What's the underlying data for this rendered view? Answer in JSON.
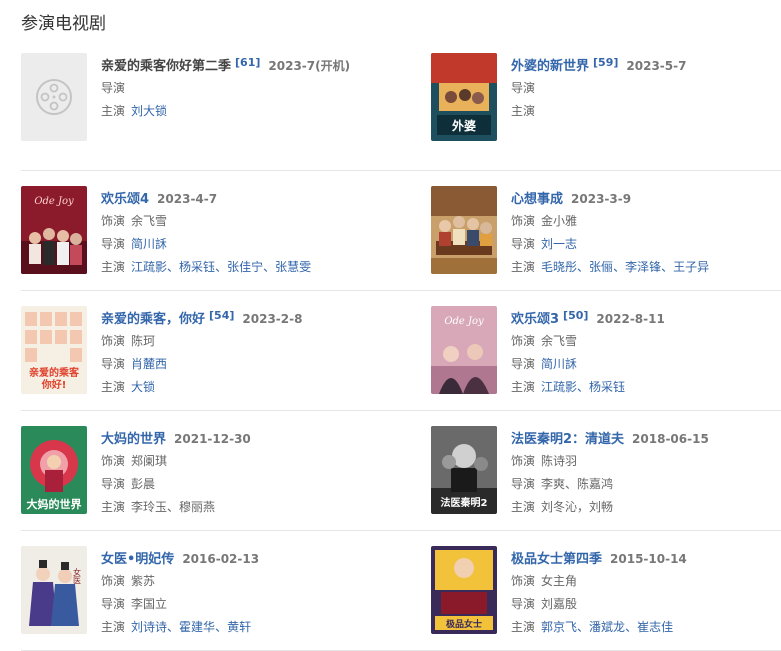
{
  "section_title": "参演电视剧",
  "labels": {
    "role": "饰演",
    "director": "导演",
    "cast": "主演"
  },
  "colors": {
    "link": "#3366aa",
    "muted": "#777777",
    "divider": "#e6e6e6"
  },
  "shows": [
    {
      "title": "亲爱的乘客你好第二季",
      "title_linked": false,
      "score": "[61]",
      "date": "2023-7(开机)",
      "poster_icon": "film-reel-placeholder-icon",
      "role": null,
      "director": [],
      "cast": [
        "刘大锁"
      ]
    },
    {
      "title": "外婆的新世界",
      "title_linked": true,
      "score": "[59]",
      "date": "2023-5-7",
      "poster_icon": "poster-waipo",
      "role": null,
      "director": [],
      "cast": []
    },
    {
      "title": "欢乐颂4",
      "title_linked": true,
      "score": null,
      "date": "2023-4-7",
      "poster_icon": "poster-huanlesong4",
      "role": "余飞雪",
      "director": [
        "简川訸"
      ],
      "cast": [
        "江疏影",
        "杨采钰",
        "张佳宁",
        "张慧雯"
      ]
    },
    {
      "title": "心想事成",
      "title_linked": true,
      "score": null,
      "date": "2023-3-9",
      "poster_icon": "poster-xinxiangshicheng",
      "role": "金小雅",
      "director": [
        "刘一志"
      ],
      "cast": [
        "毛晓彤",
        "张俪",
        "李泽锋",
        "王子异"
      ]
    },
    {
      "title": "亲爱的乘客，你好",
      "title_linked": true,
      "score": "[54]",
      "date": "2023-2-8",
      "poster_icon": "poster-chengke",
      "role": "陈珂",
      "director": [
        "肖麓西"
      ],
      "cast": [
        "大锁"
      ]
    },
    {
      "title": "欢乐颂3",
      "title_linked": true,
      "score": "[50]",
      "date": "2022-8-11",
      "poster_icon": "poster-huanlesong3",
      "role": "余飞雪",
      "director": [
        "简川訸"
      ],
      "cast": [
        "江疏影",
        "杨采钰"
      ]
    },
    {
      "title": "大妈的世界",
      "title_linked": true,
      "score": null,
      "date": "2021-12-30",
      "poster_icon": "poster-dama",
      "role": "郑阑琪",
      "director": [],
      "director_text": "彭晨",
      "cast": [],
      "cast_text": "李玲玉、穆丽燕"
    },
    {
      "title": "法医秦明2：清道夫",
      "title_linked": true,
      "score": null,
      "date": "2018-06-15",
      "poster_icon": "poster-fayi",
      "role": "陈诗羽",
      "director": [],
      "director_text": "李爽、陈嘉鸿",
      "cast": [],
      "cast_text": "刘冬沁，刘畅"
    },
    {
      "title": "女医•明妃传",
      "title_linked": true,
      "score": null,
      "date": "2016-02-13",
      "poster_icon": "poster-nvyi",
      "role": "紫苏",
      "director": [],
      "director_text": "李国立",
      "cast": [
        "刘诗诗",
        "霍建华",
        "黄轩"
      ]
    },
    {
      "title": "极品女士第四季",
      "title_linked": true,
      "score": null,
      "date": "2015-10-14",
      "poster_icon": "poster-jipin",
      "role": "女主角",
      "director": [],
      "director_text": "刘嘉殷",
      "cast": [
        "郭京飞",
        "潘斌龙",
        "崔志佳"
      ]
    }
  ]
}
